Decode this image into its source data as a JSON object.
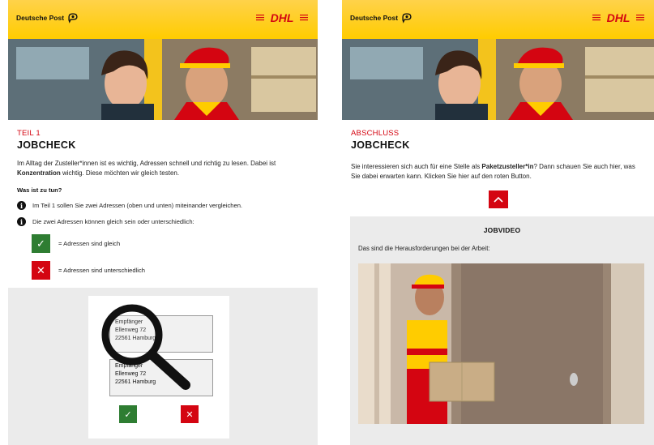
{
  "brand": {
    "name": "Deutsche Post",
    "partner_logo": "DHL"
  },
  "left": {
    "section_label": "TEIL 1",
    "title": "JOBCHECK",
    "intro_prefix": "Im Alltag der Zusteller*innen ist es wichtig, Adressen schnell und richtig zu lesen. Dabei ist ",
    "intro_bold": "Konzentration",
    "intro_suffix": " wichtig. Diese möchten wir gleich testen.",
    "question": "Was ist zu tun?",
    "info_items": [
      "Im Teil 1 sollen Sie zwei Adressen (oben und unten) miteinander vergleichen.",
      "Die zwei Adressen können gleich sein oder unterschiedlich:"
    ],
    "legend": {
      "same": "= Adressen sind gleich",
      "different": "= Adressen sind unterschiedlich"
    },
    "demo": {
      "address_top": [
        "Empfänger",
        "Ellenweg 72",
        "22561 Hamburg"
      ],
      "address_bottom": [
        "Empfänger",
        "Ellenweg 72",
        "22561 Hamburg"
      ]
    }
  },
  "right": {
    "section_label": "ABSCHLUSS",
    "title": "JOBCHECK",
    "intro_prefix": "Sie interessieren sich auch für eine Stelle als ",
    "intro_bold": "Paketzusteller*in",
    "intro_suffix": "? Dann schauen Sie auch hier, was Sie dabei erwarten kann. Klicken Sie hier auf den roten Button.",
    "video": {
      "title": "JOBVIDEO",
      "description": "Das sind die Herausforderungen bei der Arbeit:"
    }
  },
  "colors": {
    "brand_yellow": "#ffcc00",
    "brand_red": "#d40511",
    "confirm_green": "#2e7d32"
  },
  "icons": [
    "post-horn-icon",
    "info-icon",
    "checkmark-icon",
    "cross-icon",
    "magnifier-icon",
    "chevron-up-icon"
  ]
}
